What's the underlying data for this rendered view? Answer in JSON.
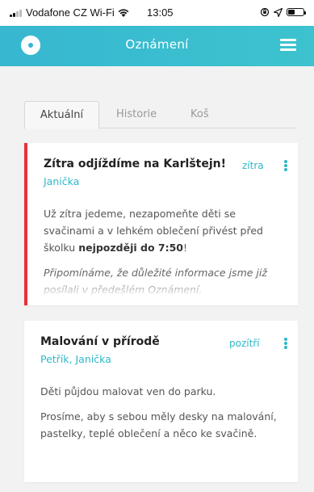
{
  "status_bar": {
    "carrier": "Vodafone CZ Wi-Fi",
    "time": "13:05"
  },
  "header": {
    "title": "Oznámení",
    "brand_color": "#37b7d0"
  },
  "tabs": [
    {
      "label": "Aktuální",
      "active": true
    },
    {
      "label": "Historie",
      "active": false
    },
    {
      "label": "Koš",
      "active": false
    }
  ],
  "notifications": [
    {
      "title": "Zítra odjíždíme na Karlštejn!",
      "date": "zítra",
      "author": "Janička",
      "accent_color": "#e2333a",
      "body_1_pre": "Už zítra jedeme, nezapomeňte děti se svačinami a v lehkém oblečení přivést před školku ",
      "body_1_bold": "nejpozději do 7:50",
      "body_1_post": "!",
      "body_2": "Připomínáme, že důležité informace jsme již posílali v předešlém Oznámení."
    },
    {
      "title": "Malování v přírodě",
      "date": "pozítří",
      "author": "Petřík, Janička",
      "body_1": "Děti půjdou malovat ven do parku.",
      "body_2": "Prosíme, aby s sebou měly desky na malování, pastelky, teplé oblečení a něco ke svačině."
    }
  ],
  "icons": {
    "logo": "logo-circle-icon",
    "menu": "hamburger-menu-icon",
    "more": "kebab-menu-icon"
  }
}
